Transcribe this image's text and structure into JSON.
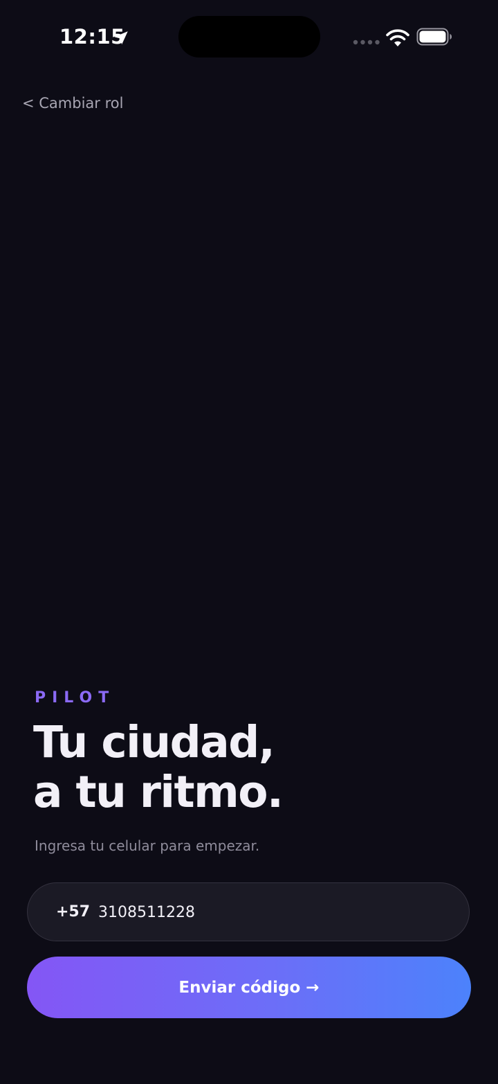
{
  "status_bar": {
    "time": "12:15"
  },
  "nav": {
    "back_label": "< Cambiar rol"
  },
  "hero": {
    "brand": "PILOT",
    "headline_line1": "Tu ciudad,",
    "headline_line2": "a tu ritmo.",
    "subtitle": "Ingresa tu celular para empezar."
  },
  "phone_form": {
    "country_code": "+57",
    "phone_value": "3108511228"
  },
  "actions": {
    "send_label": "Enviar código →"
  },
  "colors": {
    "background": "#0d0c16",
    "brand_accent": "#8b6af5",
    "gradient_start": "#8456f5",
    "gradient_end": "#4c82fb"
  },
  "icons": [
    "location-arrow-icon",
    "cellular-signal-icon",
    "wifi-icon",
    "battery-icon"
  ]
}
